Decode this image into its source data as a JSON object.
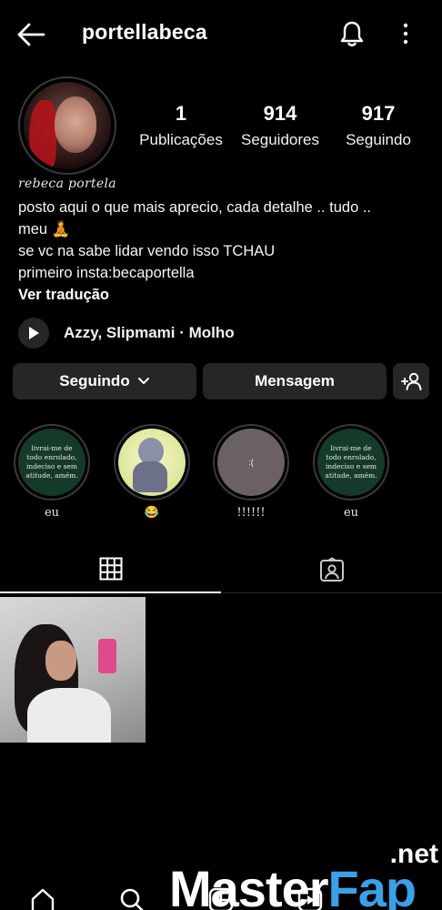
{
  "header": {
    "username": "portellabeca",
    "back_icon": "arrow-left-icon",
    "bell_icon": "bell-icon",
    "more_icon": "vertical-dots-icon"
  },
  "stats": [
    {
      "value": "1",
      "label": "Publicações"
    },
    {
      "value": "914",
      "label": "Seguidores"
    },
    {
      "value": "917",
      "label": "Seguindo"
    }
  ],
  "bio": {
    "display_name": "rebeca portela",
    "lines": [
      "posto aqui o que mais aprecio, cada detalhe .. tudo ..",
      "meu 🧘",
      "se vc na sabe lidar vendo isso TCHAU",
      "primeiro insta:becaportella"
    ],
    "translate_label": "Ver tradução"
  },
  "music": {
    "track": "Azzy, Slipmami · Molho"
  },
  "buttons": {
    "following_label": "Seguindo",
    "message_label": "Mensagem"
  },
  "highlights": [
    {
      "caption": "eu",
      "text": "livrai-me de todo enrolado, indeciso e sem atitude, amém."
    },
    {
      "caption": "😂",
      "text": ""
    },
    {
      "caption": "!!!!!!",
      "text": ":("
    },
    {
      "caption": "eu",
      "text": "livrai-me de todo enrolado, indeciso e sem atitude, amém."
    }
  ],
  "tabs": [
    "grid-icon",
    "tagged-icon"
  ],
  "watermark": {
    "net": ".net",
    "brand_part1": "Master",
    "brand_part2": "Fap"
  },
  "colors": {
    "background": "#000000",
    "button_bg": "#262626",
    "highlight_green": "#163a2a",
    "watermark_accent": "#3aa0e8"
  }
}
